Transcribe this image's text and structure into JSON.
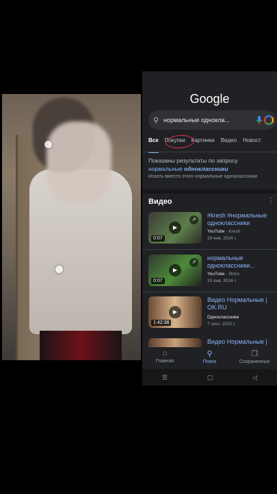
{
  "google_logo": "Google",
  "search": {
    "query": "нормальные однокла..."
  },
  "tabs": [
    "Все",
    "Покупки",
    "Картинки",
    "Видео",
    "Новост"
  ],
  "correction": {
    "line1": "Показаны результаты по запросу",
    "line2_prefix": "нормальные ",
    "line2_bold": "одноклассники",
    "line3": "Искать вместо этого нормальные одноклассники"
  },
  "videos_heading": "Видео",
  "videos": [
    {
      "title": "#kresh #нормальные одноклассники",
      "source": "YouTube",
      "channel": "Kresh",
      "date": "19 янв. 2024 г.",
      "duration": "0:07"
    },
    {
      "title": "нормальные одноклассники...",
      "source": "YouTube",
      "channel": "0ln1x",
      "date": "20 янв. 2024 г.",
      "duration": "0:07"
    },
    {
      "title": "Видео Нормальные | OK.RU",
      "source": "Одноклассники",
      "channel": "",
      "date": "7 сент. 2022 г.",
      "duration": "1:42:38"
    },
    {
      "title": "Видео Нормальные |",
      "source": "",
      "channel": "",
      "date": "",
      "duration": ""
    }
  ],
  "bottom_nav": {
    "home": "Главная",
    "search": "Поиск",
    "saved": "Сохраненные"
  }
}
